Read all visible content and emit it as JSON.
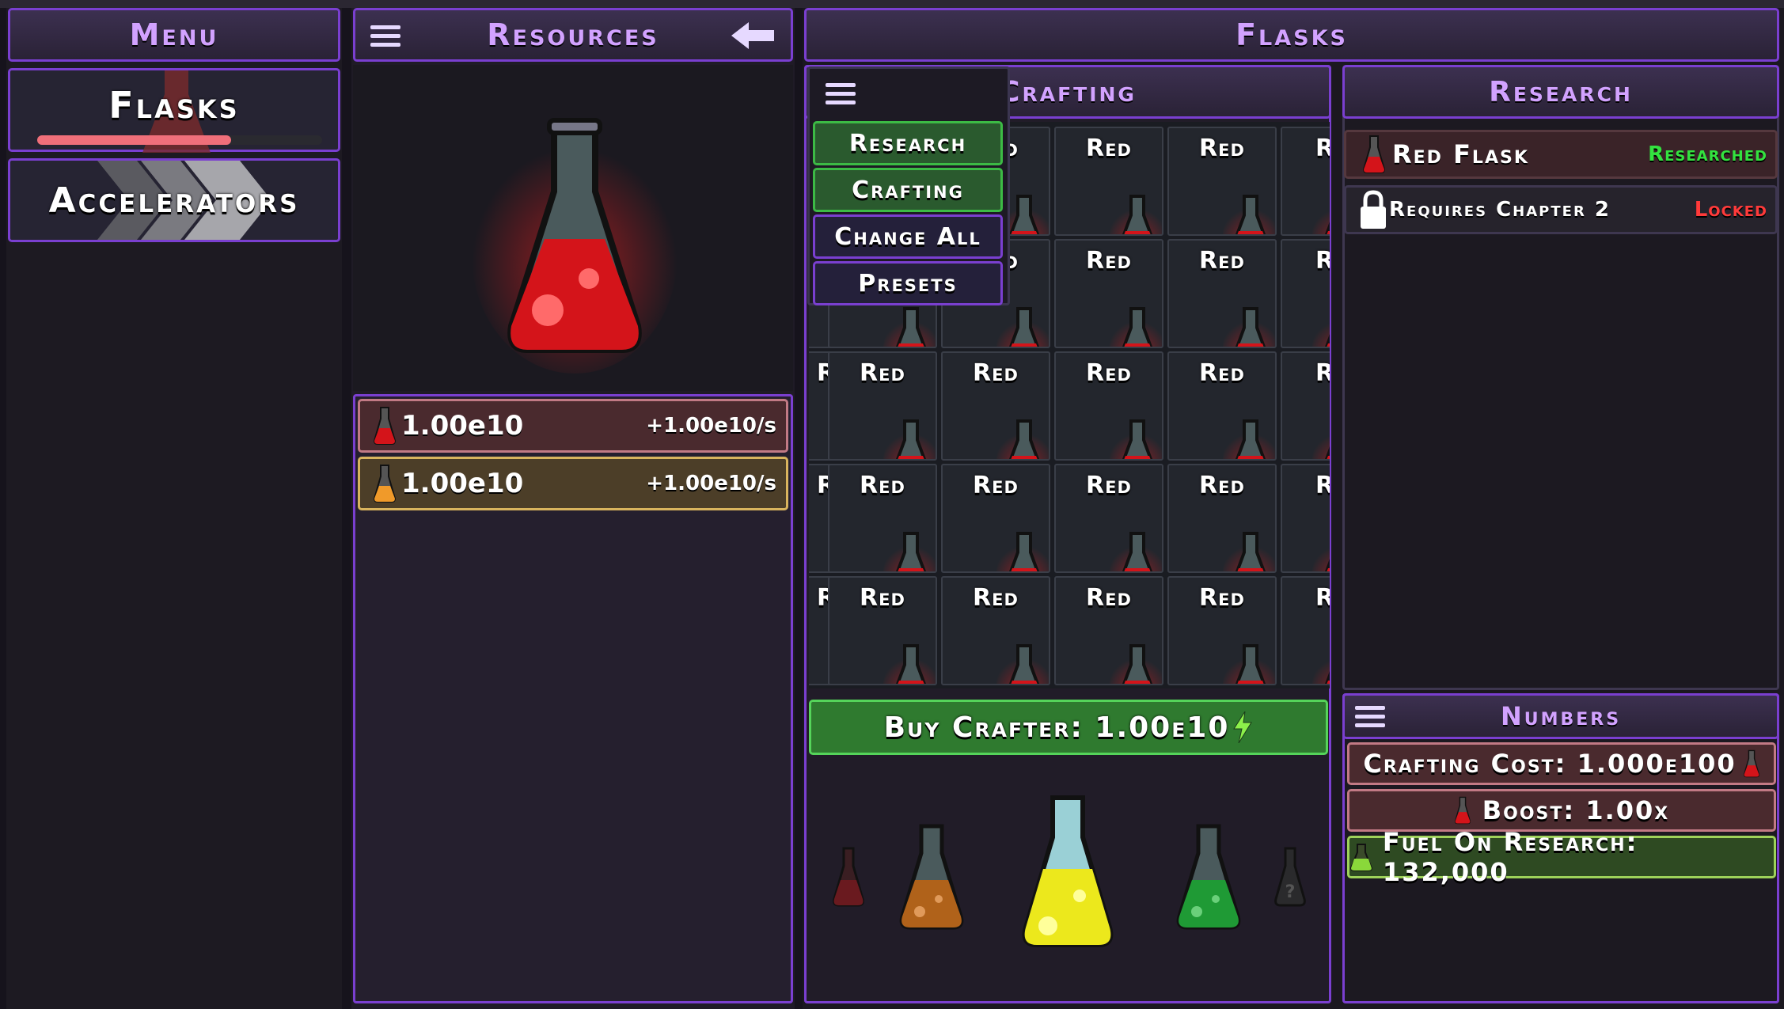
{
  "menu": {
    "title": "Menu",
    "items": [
      {
        "label": "Flasks",
        "progress": 0.68
      },
      {
        "label": "Accelerators"
      }
    ]
  },
  "resources": {
    "title": "Resources",
    "rows": [
      {
        "amount": "1.00e10",
        "rate": "+1.00e10/s",
        "color": "#b8262b"
      },
      {
        "amount": "1.00e10",
        "rate": "+1.00e10/s",
        "color": "#e8912a"
      }
    ]
  },
  "flasks": {
    "title": "Flasks",
    "crafting": {
      "title": "Crafting",
      "cell_label": "Red",
      "visible_partial_label": "R",
      "dropdown": [
        "Research",
        "Crafting",
        "Change All",
        "Presets"
      ],
      "buy_button": "Buy Crafter: 1.00e10"
    },
    "research": {
      "title": "Research",
      "rows": [
        {
          "name": "Red Flask",
          "status": "Researched",
          "status_color": "#33e23f"
        },
        {
          "name": "Requires Chapter 2",
          "status": "Locked",
          "status_color": "#ff3a3a"
        }
      ]
    },
    "numbers": {
      "title": "Numbers",
      "rows": [
        {
          "label": "Crafting Cost: 1.000e100"
        },
        {
          "label": "Boost: 1.00x"
        },
        {
          "label": "Fuel On Research: 132,000"
        }
      ]
    },
    "carousel_colors": [
      "#7a1a1f",
      "#c9701e",
      "#f0ee20",
      "#1fa235",
      "#333333"
    ]
  }
}
